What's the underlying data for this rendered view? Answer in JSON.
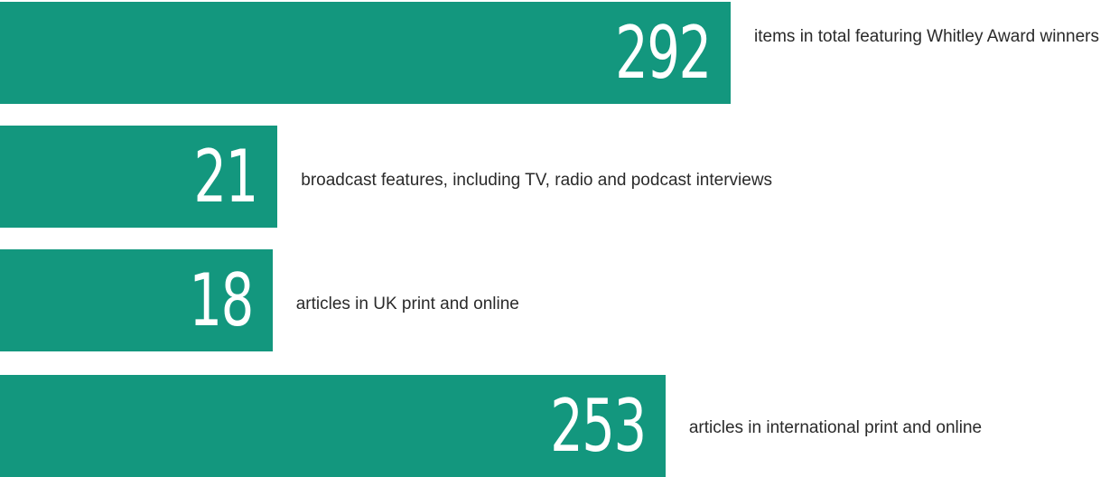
{
  "chart_data": {
    "type": "bar",
    "orientation": "horizontal",
    "bar_color": "#13977e",
    "value_color": "#ffffff",
    "label_color": "#2a2a2a",
    "categories": [
      "items in total featuring Whitley Award winners",
      "broadcast features, including TV, radio and podcast interviews",
      "articles in UK print and online",
      "articles in international print and online"
    ],
    "values": [
      292,
      21,
      18,
      253
    ],
    "value_labels": [
      "292",
      "21",
      "18",
      "253"
    ]
  }
}
